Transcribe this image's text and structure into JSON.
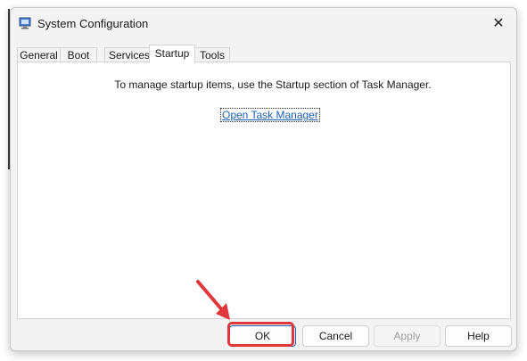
{
  "window": {
    "title": "System Configuration"
  },
  "tabs": [
    {
      "label": "General",
      "active": false
    },
    {
      "label": "Boot",
      "active": false
    },
    {
      "label": "Services",
      "active": false
    },
    {
      "label": "Startup",
      "active": true
    },
    {
      "label": "Tools",
      "active": false
    }
  ],
  "startup_panel": {
    "message": "To manage startup items, use the Startup section of Task Manager.",
    "link": "Open Task Manager"
  },
  "buttons": {
    "ok": "OK",
    "cancel": "Cancel",
    "apply": "Apply",
    "help": "Help"
  },
  "annotation": {
    "color": "#e0373b"
  },
  "colors": {
    "link": "#1a5fb4",
    "accent": "#1a5fb4"
  },
  "icons": {
    "app": "msconfig-icon",
    "close": "close-icon"
  }
}
